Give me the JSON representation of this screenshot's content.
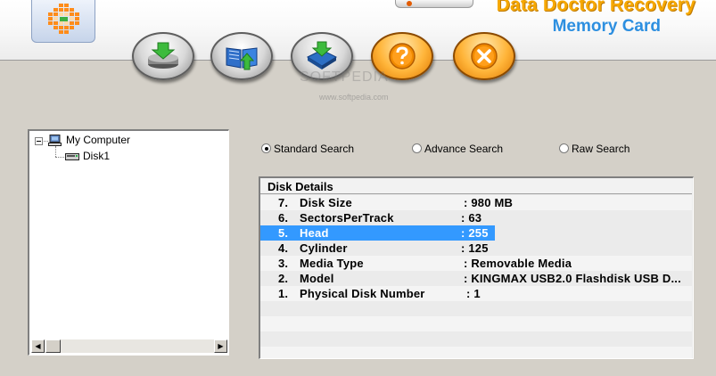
{
  "app": {
    "brand_line1": "Data Doctor Recovery",
    "brand_line2": "Memory Card"
  },
  "watermark": {
    "main": "SOFTPEDIA",
    "url": "www.softpedia.com"
  },
  "toolbar": {
    "buttons": [
      {
        "icon": "drive-save-icon",
        "color": "gray"
      },
      {
        "icon": "open-book-icon",
        "color": "gray"
      },
      {
        "icon": "disk-download-icon",
        "color": "gray"
      },
      {
        "icon": "help-icon",
        "color": "orange"
      },
      {
        "icon": "close-icon",
        "color": "orange"
      }
    ]
  },
  "tree": {
    "root": "My Computer",
    "child": "Disk1"
  },
  "search_mode": {
    "options": [
      "Standard Search",
      "Advance Search",
      "Raw Search"
    ],
    "selected": "Standard Search"
  },
  "disk_details": {
    "title": "Disk Details",
    "rows": [
      {
        "num": "7.",
        "label": "Disk Size",
        "value": ": 980 MB"
      },
      {
        "num": "6.",
        "label": "SectorsPerTrack",
        "value": ": 63"
      },
      {
        "num": "5.",
        "label": "Head",
        "value": ": 255",
        "selected": true
      },
      {
        "num": "4.",
        "label": "Cylinder",
        "value": ": 125"
      },
      {
        "num": "3.",
        "label": "Media Type",
        "value": ": Removable Media"
      },
      {
        "num": "2.",
        "label": "Model",
        "value": ": KINGMAX USB2.0 Flashdisk USB D..."
      },
      {
        "num": "1.",
        "label": "Physical Disk Number",
        "value": ": 1"
      }
    ]
  },
  "colors": {
    "brand_orange": "#f6a800",
    "brand_blue": "#2d8fe0",
    "selection": "#3399ff"
  }
}
